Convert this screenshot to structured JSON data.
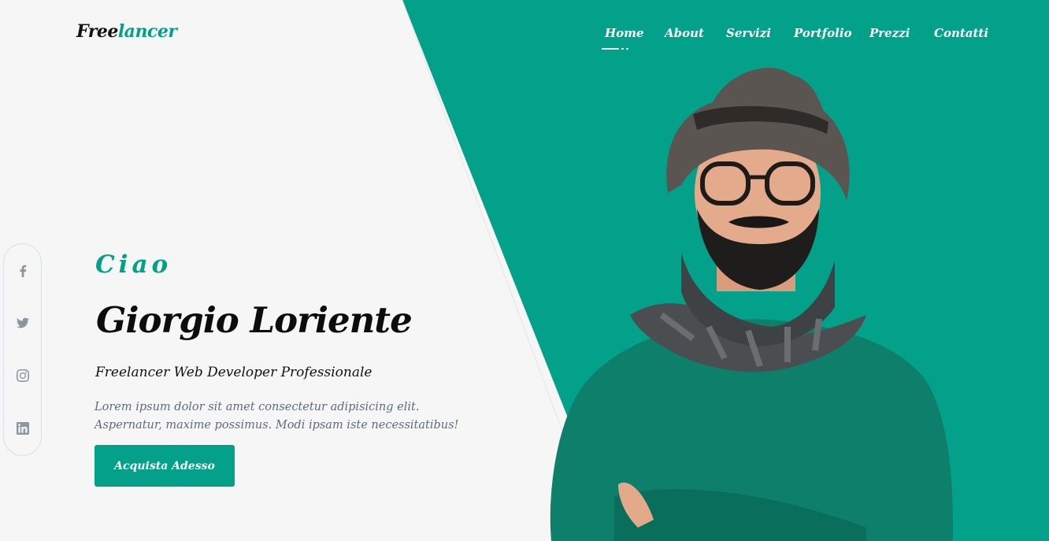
{
  "brand": {
    "part1": "Free",
    "part2": "lancer",
    "accent_color": "#03a189"
  },
  "nav": {
    "items": [
      "Home",
      "About",
      "Servizi",
      "Portfolio",
      "Prezzi",
      "Contatti"
    ],
    "active": "Home"
  },
  "social": [
    "facebook-icon",
    "twitter-icon",
    "instagram-icon",
    "linkedin-icon"
  ],
  "hero": {
    "greeting": "Ciao",
    "name": "Giorgio Loriente",
    "subtitle": "Freelancer Web Developer Professionale",
    "description": "Lorem ipsum dolor sit amet consectetur adipisicing elit. Aspernatur, maxime possimus. Modi ipsam iste necessitatibus!",
    "cta_label": "Acquista Adesso"
  },
  "colors": {
    "green": "#03a189",
    "background": "#f6f6f7",
    "sweater": "#0d7f6a"
  }
}
